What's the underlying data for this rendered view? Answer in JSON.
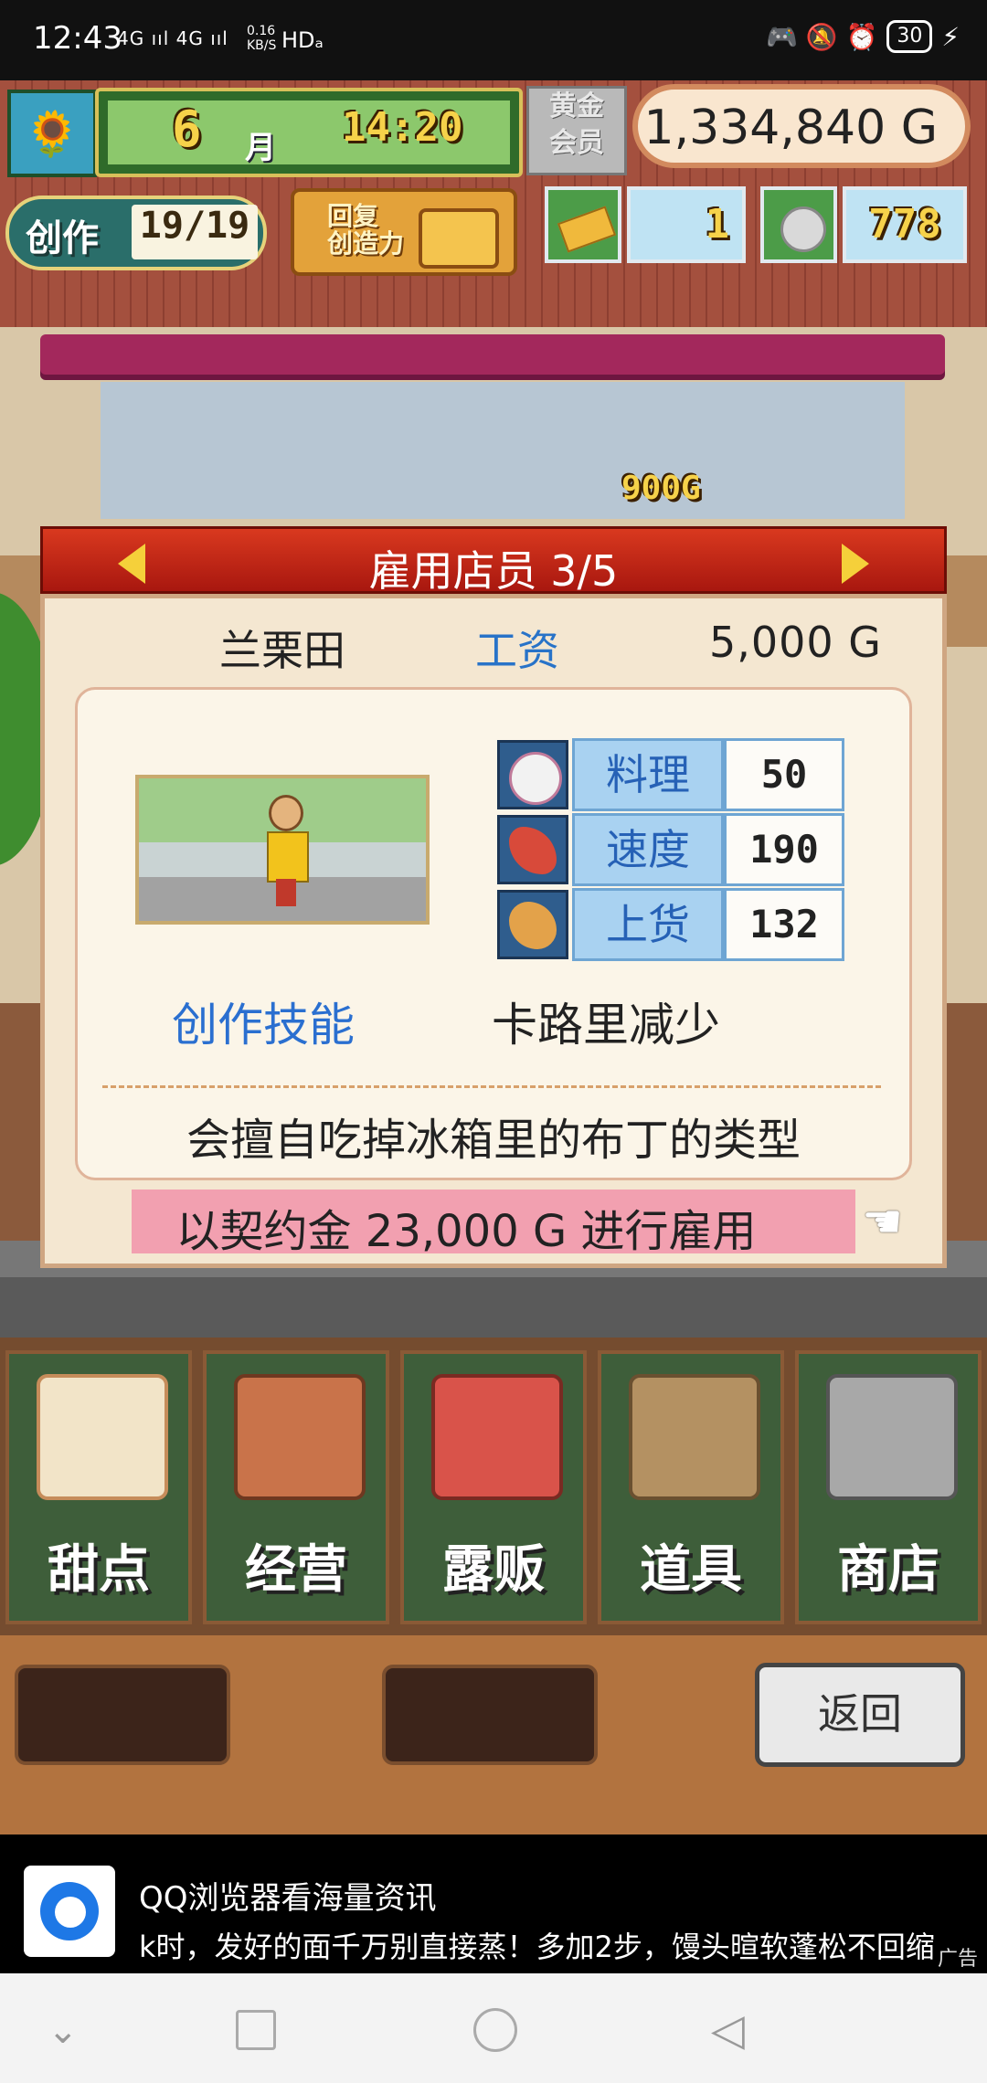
{
  "status_bar": {
    "time": "12:43",
    "signal": "4G ııl 4G ııl",
    "speed_top": "0.16",
    "speed_bottom": "KB/S",
    "hd": "HDₐ",
    "right_icons": "🎮 🔕 ⏰",
    "battery": "30"
  },
  "hud": {
    "month": "6",
    "month_unit": "月",
    "clock": "14:20",
    "member_tag": "黄金\n会员",
    "money": "1,334,840 G",
    "create_label": "创作",
    "create_count": "19/19",
    "restore_label": "回复\n创造力",
    "ticket_count": "1",
    "medal_count": "778",
    "floating_price": "900G"
  },
  "dialog": {
    "title": "雇用店员 3/5",
    "name": "兰栗田",
    "salary_label": "工资",
    "salary_value": "5,000  G",
    "stats": [
      {
        "label": "料理",
        "value": "50",
        "icon": "cooking-bowl-icon"
      },
      {
        "label": "速度",
        "value": "190",
        "icon": "rocket-icon"
      },
      {
        "label": "上货",
        "value": "132",
        "icon": "bread-icon"
      }
    ],
    "skill_label": "创作技能",
    "skill_value": "卡路里减少",
    "description": "会擅自吃掉冰箱里的布丁的类型",
    "hire_text": "以契约金 23,000 G  进行雇用"
  },
  "menu": [
    {
      "label": "甜点",
      "icon": "cake-icon"
    },
    {
      "label": "经营",
      "icon": "shop-icon"
    },
    {
      "label": "露贩",
      "icon": "food-truck-icon"
    },
    {
      "label": "道具",
      "icon": "items-icon"
    },
    {
      "label": "商店",
      "icon": "cart-icon"
    }
  ],
  "bottom": {
    "back_label": "返回"
  },
  "ad": {
    "title": "QQ浏览器看海量资讯",
    "text": "k时，发好的面千万别直接蒸！多加2步，馒头暄软蓬松不回缩",
    "tag": "广告"
  },
  "colors": {
    "dialog_header": "#c0291a",
    "stat_label_blue": "#2661b6",
    "hire_pink": "#f2a0b0"
  }
}
